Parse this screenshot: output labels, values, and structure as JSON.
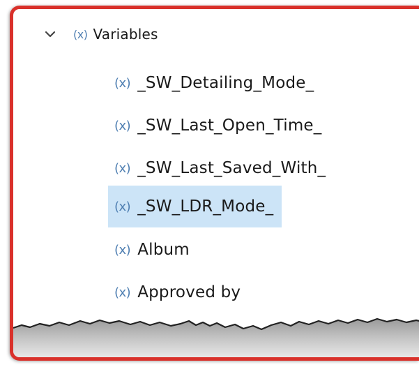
{
  "tree": {
    "root": {
      "label": "Variables",
      "expanded": true,
      "icon": "variable-icon",
      "icon_text": "(x)",
      "chevron_icon": "chevron-down-icon"
    },
    "items": [
      {
        "label": "_SW_Detailing_Mode_",
        "icon_text": "(x)",
        "selected": false
      },
      {
        "label": "_SW_Last_Open_Time_",
        "icon_text": "(x)",
        "selected": false
      },
      {
        "label": "_SW_Last_Saved_With_",
        "icon_text": "(x)",
        "selected": false
      },
      {
        "label": "_SW_LDR_Mode_",
        "icon_text": "(x)",
        "selected": true
      },
      {
        "label": "Album",
        "icon_text": "(x)",
        "selected": false
      },
      {
        "label": "Approved by",
        "icon_text": "(x)",
        "selected": false
      }
    ]
  },
  "colors": {
    "frame_border": "#d9312b",
    "selection": "#cce4f7",
    "icon": "#4f7fb2",
    "text": "#1a1a1a"
  }
}
